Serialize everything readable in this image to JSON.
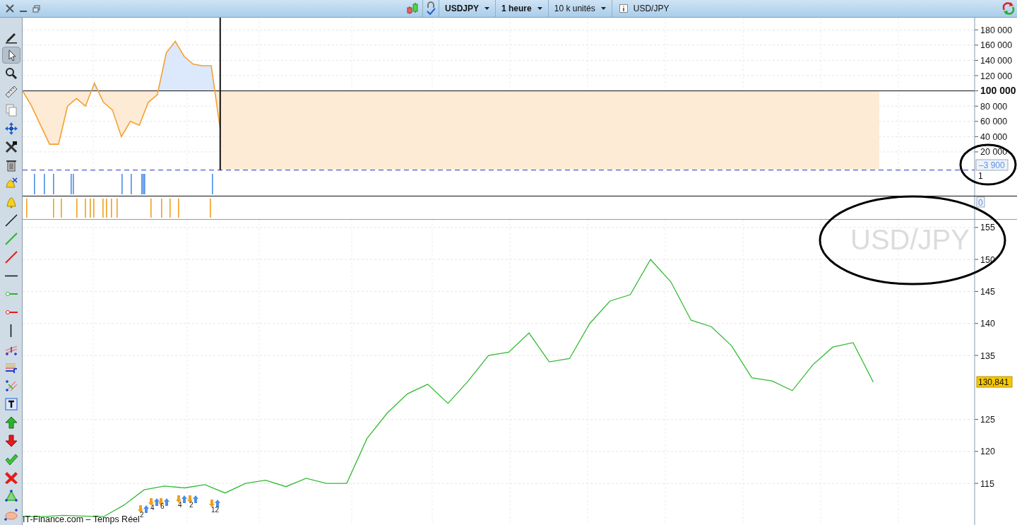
{
  "toolbar": {
    "symbol": "USDJPY",
    "timeframe": "1 heure",
    "size": "10 k unités",
    "instrument": "USD/JPY"
  },
  "tools": [
    {
      "kind": "pencil",
      "selected": false
    },
    {
      "kind": "pointer",
      "selected": true
    },
    {
      "kind": "zoom",
      "selected": false
    },
    {
      "kind": "ruler",
      "selected": false
    },
    {
      "kind": "copy",
      "selected": false
    },
    {
      "kind": "move",
      "selected": false
    },
    {
      "kind": "tools",
      "selected": false
    },
    {
      "kind": "trash",
      "selected": false
    },
    {
      "kind": "bell-pointer",
      "selected": false
    },
    {
      "kind": "bell",
      "selected": false
    },
    {
      "kind": "line",
      "selected": false
    },
    {
      "kind": "uptrend-line",
      "selected": false
    },
    {
      "kind": "downtrend-line",
      "selected": false
    },
    {
      "kind": "hline",
      "selected": false
    },
    {
      "kind": "buy-level",
      "selected": false
    },
    {
      "kind": "sell-level",
      "selected": false
    },
    {
      "kind": "vline",
      "selected": false
    },
    {
      "kind": "channel",
      "selected": false
    },
    {
      "kind": "levels",
      "selected": false
    },
    {
      "kind": "grid",
      "selected": false
    },
    {
      "kind": "textbox",
      "selected": false
    },
    {
      "kind": "arrow-up",
      "selected": false
    },
    {
      "kind": "arrow-down",
      "selected": false
    },
    {
      "kind": "validate",
      "selected": false
    },
    {
      "kind": "cross",
      "selected": false
    },
    {
      "kind": "triangle",
      "selected": false
    },
    {
      "kind": "ellipse",
      "selected": false
    }
  ],
  "position_pane": {
    "current_label": "–3 900",
    "chart_data": {
      "type": "line",
      "grid": true,
      "series": [
        {
          "color": "#f5a030",
          "values": [
            100000,
            80000,
            55000,
            30000,
            30000,
            80000,
            90000,
            80000,
            110000,
            85000,
            75000,
            40000,
            60000,
            55000,
            85000,
            95000,
            150000,
            165000,
            145000,
            135000,
            133000,
            133000,
            50000,
            null,
            null,
            null,
            null,
            null,
            null,
            null,
            null,
            null,
            null,
            null,
            null,
            null,
            null,
            null,
            null,
            null,
            null,
            null,
            null,
            null,
            null,
            null,
            null,
            null,
            null,
            null,
            null,
            null,
            null,
            null,
            null,
            null,
            null,
            null,
            null,
            null,
            null,
            null,
            null,
            null,
            null,
            null,
            null,
            null,
            null,
            null,
            null,
            null,
            null,
            null,
            null,
            null,
            null,
            null,
            null,
            null,
            null,
            null,
            null,
            null,
            null,
            null,
            null,
            null,
            null,
            null,
            null,
            null,
            null,
            null,
            null,
            null,
            null,
            null,
            null,
            null,
            null,
            null,
            null,
            null,
            null,
            null,
            null
          ]
        }
      ],
      "ylim": [
        -6000,
        196000
      ],
      "yticks": [
        {
          "value": 20000,
          "label": "20 000"
        },
        {
          "value": 40000,
          "label": "40 000"
        },
        {
          "value": 60000,
          "label": "60 000"
        },
        {
          "value": 80000,
          "label": "80 000"
        },
        {
          "value": 100000,
          "label": "100 000"
        },
        {
          "value": 120000,
          "label": "120 000"
        },
        {
          "value": 140000,
          "label": "140 000"
        },
        {
          "value": 160000,
          "label": "160 000"
        },
        {
          "value": 180000,
          "label": "180 000"
        }
      ],
      "ref_lines": [
        {
          "axis": "y",
          "value": 100000,
          "color": "#111111"
        },
        {
          "axis": "y",
          "value": -3900,
          "color": "#2233cc"
        }
      ]
    }
  },
  "buy_pane": {
    "axis_label": "1"
  },
  "sell_pane": {
    "axis_label": "0"
  },
  "price_pane": {
    "watermark": "USD/JPY",
    "price_label": "130,841",
    "trade_markers": [
      {
        "count": "2"
      },
      {
        "count": "4"
      },
      {
        "count": "6"
      },
      {
        "count": "4"
      },
      {
        "count": "2"
      },
      {
        "count": "12"
      }
    ],
    "chart_data": {
      "type": "line",
      "grid": true,
      "series": [
        {
          "color": "#33bb33",
          "values": [
            109.8,
            109.8,
            110,
            109.9,
            109.8,
            111.6,
            114,
            114.6,
            114.3,
            114.8,
            113.5,
            115,
            115.5,
            114.5,
            115.8,
            115,
            115,
            122,
            126,
            129,
            130.5,
            127.5,
            131,
            135,
            135.5,
            138.5,
            134,
            134.5,
            140,
            143.5,
            144.5,
            150,
            146.5,
            140.5,
            139.5,
            136.5,
            131.5,
            131,
            129.5,
            133.5,
            136.3,
            137,
            130.8,
            null,
            null,
            null,
            null,
            null
          ]
        }
      ],
      "ylim": [
        108.5,
        156.2
      ],
      "yticks": [
        115,
        120,
        125,
        135,
        140,
        145,
        150,
        155
      ]
    }
  },
  "footer": "IT-Finance.com – Temps Réel"
}
